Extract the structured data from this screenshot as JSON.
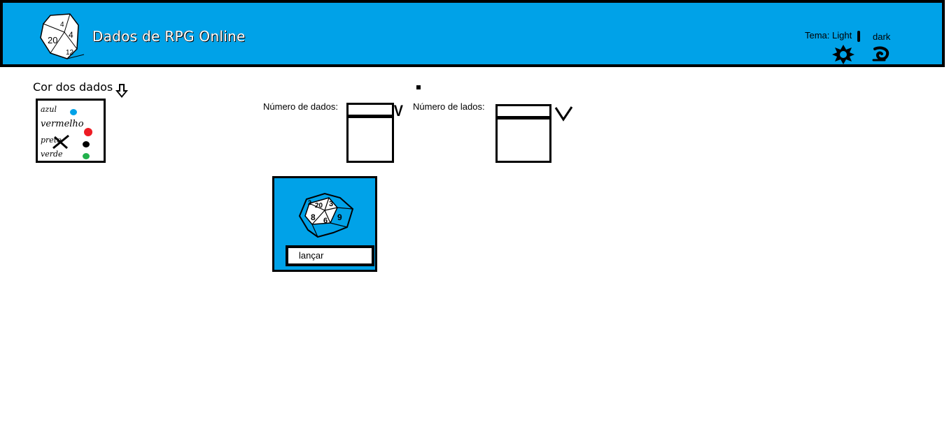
{
  "header": {
    "title": "Dados de RPG Online",
    "theme_label": "Tema: Light",
    "dark_label": "dark",
    "logo_numbers": [
      "4",
      "20",
      "4",
      "12"
    ],
    "colors": {
      "header_bg": "#00a2e8",
      "border": "#000000",
      "title": "#ffffff"
    }
  },
  "color_selector": {
    "label": "Cor dos dados",
    "options": [
      {
        "label": "azul",
        "color": "#00a2e8"
      },
      {
        "label": "vermelho",
        "color": "#ed1c24"
      },
      {
        "label": "preto",
        "color": "#000000"
      },
      {
        "label": "verde",
        "color": "#22b14c"
      }
    ]
  },
  "dice_count": {
    "label": "Número de dados:",
    "chevron": "V"
  },
  "sides": {
    "label": "Número de lados:"
  },
  "roll": {
    "button_label": "lançar",
    "die_numbers": [
      "2",
      "20",
      "3",
      "8",
      "6",
      "9"
    ],
    "panel_color": "#00a2e8"
  },
  "icons": [
    "d20-logo-icon",
    "sun-icon",
    "moon-icon",
    "down-arrow-icon",
    "chevron-down-icon",
    "d20-icon"
  ]
}
